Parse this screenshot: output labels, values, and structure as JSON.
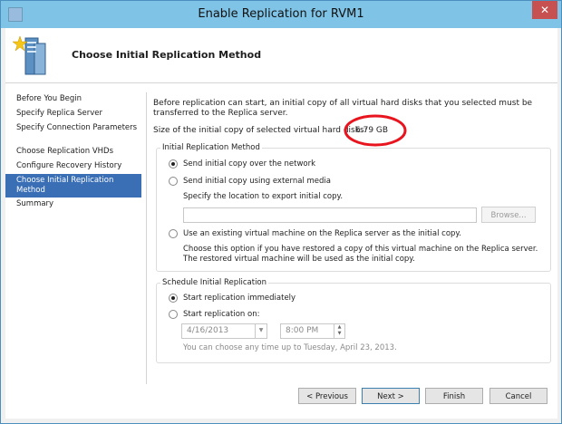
{
  "window": {
    "title": "Enable Replication for RVM1",
    "close_glyph": "✕"
  },
  "header": {
    "heading": "Choose Initial Replication Method",
    "icon": "server-icon"
  },
  "nav": {
    "items": [
      {
        "label": "Before You Begin"
      },
      {
        "label": "Specify Replica Server"
      },
      {
        "label": "Specify Connection Parameters"
      },
      {
        "label": "Choose Replication VHDs"
      },
      {
        "label": "Configure Recovery History"
      },
      {
        "label": "Choose Initial Replication Method",
        "selected": true
      },
      {
        "label": "Summary"
      }
    ]
  },
  "content": {
    "intro": "Before replication can start, an initial copy of all virtual hard disks that you selected must be transferred to the Replica server.",
    "size_label": "Size of the initial copy of selected virtual hard disks:",
    "size_value": "6.79 GB",
    "annotation_color": "#e8141e"
  },
  "initial_method": {
    "legend": "Initial Replication Method",
    "opt_network": "Send initial copy over the network",
    "opt_external": "Send initial copy using external media",
    "export_label": "Specify the location to export initial copy.",
    "export_path": "",
    "browse_label": "Browse...",
    "opt_existing": "Use an existing virtual machine on the Replica server as the initial copy.",
    "existing_help": "Choose this option if you have restored a copy of this virtual machine on the Replica server. The restored virtual machine will be used as the initial copy.",
    "selected": "network"
  },
  "schedule": {
    "legend": "Schedule Initial Replication",
    "opt_immediate": "Start replication immediately",
    "opt_on": "Start replication on:",
    "date": "4/16/2013",
    "time": "8:00 PM",
    "help": "You can choose any time up to Tuesday, April 23, 2013.",
    "selected": "immediate"
  },
  "buttons": {
    "previous": "< Previous",
    "next": "Next >",
    "finish": "Finish",
    "cancel": "Cancel"
  },
  "colors": {
    "accent": "#3a6fb5",
    "titlebar": "#7fc3e6",
    "close": "#c75050"
  }
}
